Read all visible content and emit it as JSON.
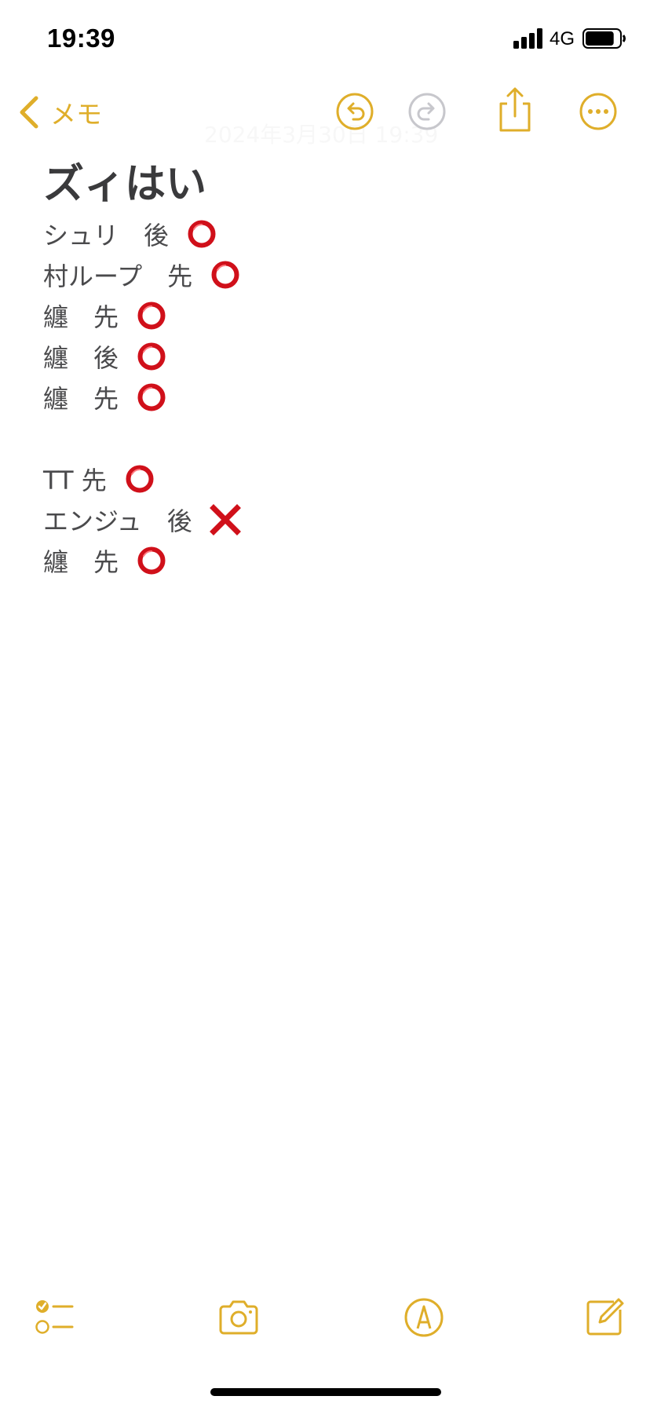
{
  "status_bar": {
    "time": "19:39",
    "network": "4G",
    "battery_level": 0.85
  },
  "nav": {
    "back_label": "メモ",
    "faded_date": "2024年3月30日 19:39"
  },
  "note": {
    "title": "ズィはい",
    "lines": [
      {
        "text": "シュリ　後",
        "mark": "circle"
      },
      {
        "text": "村ループ　先",
        "mark": "circle"
      },
      {
        "text": "纏　先",
        "mark": "circle"
      },
      {
        "text": "纏　後",
        "mark": "circle"
      },
      {
        "text": "纏　先",
        "mark": "circle"
      },
      {
        "text": "",
        "mark": ""
      },
      {
        "text": "TT 先",
        "mark": "circle"
      },
      {
        "text": "エンジュ　後",
        "mark": "cross"
      },
      {
        "text": "纏　先",
        "mark": "circle"
      }
    ]
  },
  "icons": {
    "back": "chevron-left-icon",
    "undo": "undo-icon",
    "redo": "redo-icon",
    "share": "share-icon",
    "more": "ellipsis-circle-icon",
    "checklist": "checklist-icon",
    "camera": "camera-icon",
    "markup": "markup-pen-icon",
    "compose": "compose-icon"
  },
  "colors": {
    "accent": "#dfae2a",
    "disabled": "#c7c7cc",
    "text": "#3a3a3c",
    "mark_red": "#d0101a"
  }
}
